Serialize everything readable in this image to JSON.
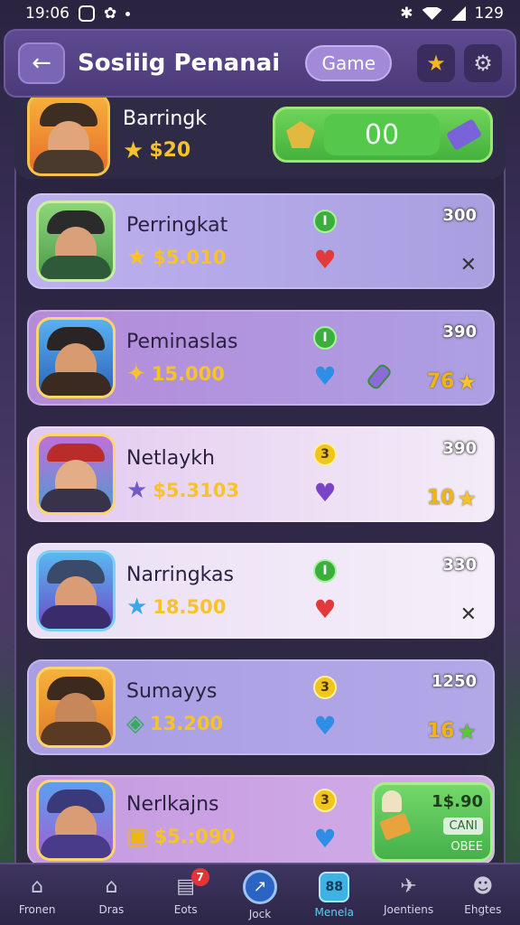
{
  "status_bar": {
    "time": "19:06",
    "battery": "129"
  },
  "header": {
    "title": "Sosiiig Penanai",
    "game_label": "Game"
  },
  "top_card": {
    "name": "Barringk",
    "price": "$20",
    "counter": "00"
  },
  "cards": [
    {
      "name": "Perringkat",
      "price": "$5.010",
      "badge": "I",
      "score": "300",
      "rank": "",
      "heart": "red",
      "right_icon": "x",
      "bg": "#b2a6e6"
    },
    {
      "name": "Peminaslas",
      "price": "15.000",
      "badge": "I",
      "score": "390",
      "rank": "76",
      "heart": "blue",
      "right_icon": "",
      "bg": "#b899e0"
    },
    {
      "name": "Netlaykh",
      "price": "$5.3103",
      "badge": "3",
      "score": "390",
      "rank": "10",
      "heart": "purple",
      "right_icon": "",
      "bg": "#efe1f4"
    },
    {
      "name": "Narringkas",
      "price": "18.500",
      "badge": "I",
      "score": "330",
      "rank": "",
      "heart": "red",
      "right_icon": "x",
      "bg": "#f1e4f7"
    },
    {
      "name": "Sumayys",
      "price": "13.200",
      "badge": "3",
      "score": "1250",
      "rank": "16",
      "heart": "blue",
      "right_icon": "",
      "bg": "#a89ee0"
    },
    {
      "name": "Nerlkajns",
      "price": "$5.:090",
      "badge": "3",
      "score": "",
      "rank": "",
      "heart": "blue",
      "right_icon": "",
      "bg": "#c6a4e2"
    }
  ],
  "reward": {
    "amount": "1$.90",
    "cancel": "CANI",
    "label": "OBEE"
  },
  "nav": [
    {
      "label": "Fronen",
      "icon": "home-icon"
    },
    {
      "label": "Dras",
      "icon": "house-icon"
    },
    {
      "label": "Eots",
      "icon": "chest-icon",
      "badge": "7"
    },
    {
      "label": "Jock",
      "icon": "compass-icon"
    },
    {
      "label": "Menela",
      "icon": "grid-icon"
    },
    {
      "label": "Joentiens",
      "icon": "plane-icon"
    },
    {
      "label": "Ehgtes",
      "icon": "profile-icon"
    }
  ]
}
